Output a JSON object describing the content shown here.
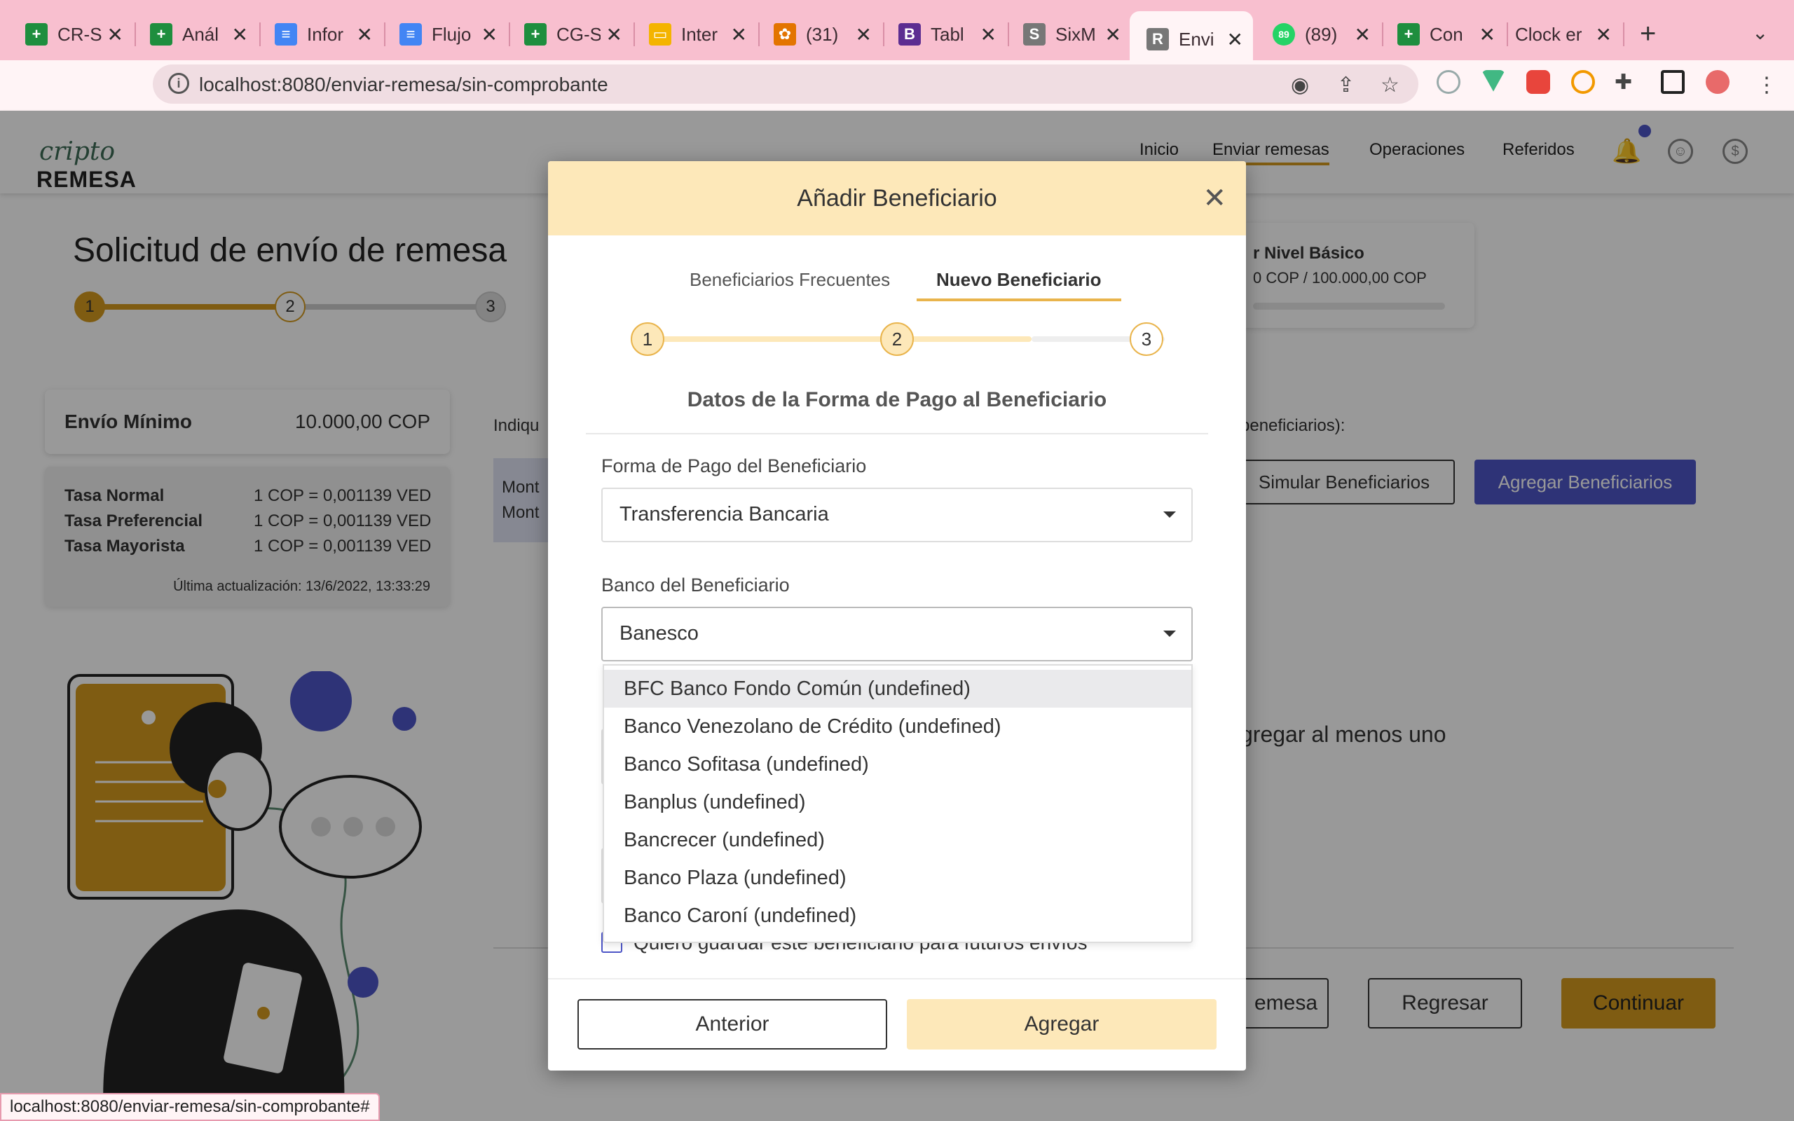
{
  "browser": {
    "tabs": [
      {
        "title": "CR-S",
        "color": "#1e8e3e",
        "glyph": "+"
      },
      {
        "title": "Anál",
        "color": "#1e8e3e",
        "glyph": "+"
      },
      {
        "title": "Infor",
        "color": "#4285f4",
        "glyph": "≡"
      },
      {
        "title": "Flujo",
        "color": "#4285f4",
        "glyph": "≡"
      },
      {
        "title": "CG-S",
        "color": "#1e8e3e",
        "glyph": "+"
      },
      {
        "title": "Inter",
        "color": "#f4b400",
        "glyph": "▭"
      },
      {
        "title": "(31)",
        "color": "#e37400",
        "glyph": "✿"
      },
      {
        "title": "Tabl",
        "color": "#5c2d91",
        "glyph": "B"
      },
      {
        "title": "SixM",
        "color": "#777777",
        "glyph": "S"
      },
      {
        "title": "Envi",
        "color": "#777777",
        "glyph": "R"
      },
      {
        "title": "(89)",
        "color": "#25d366",
        "glyph": "89"
      },
      {
        "title": "Con",
        "color": "#1e8e3e",
        "glyph": "+"
      },
      {
        "title": "Clock er",
        "color": "",
        "glyph": ""
      }
    ],
    "url": "localhost:8080/enviar-remesa/sin-comprobante",
    "status_url": "localhost:8080/enviar-remesa/sin-comprobante#"
  },
  "site": {
    "logo_top": "cripto",
    "logo_bottom": "REMESA",
    "nav": [
      "Inicio",
      "Enviar remesas",
      "Operaciones",
      "Referidos"
    ]
  },
  "page": {
    "title": "Solicitud de envío de remesa",
    "steps": [
      "1",
      "2",
      "3"
    ],
    "min_label": "Envío Mínimo",
    "min_value": "10.000,00 COP",
    "rates": [
      {
        "label": "Tasa Normal",
        "value": "1 COP = 0,001139 VED"
      },
      {
        "label": "Tasa Preferencial",
        "value": "1 COP = 0,001139 VED"
      },
      {
        "label": "Tasa Mayorista",
        "value": "1 COP = 0,001139 VED"
      }
    ],
    "last_update": "Última actualización: 13/6/2022, 13:33:29",
    "limit_title": "r Nivel Básico",
    "limit_value": "0 COP / 100.000,00 COP",
    "indique": "Indiqu",
    "monto_lines": [
      "Mont",
      "Mont"
    ],
    "benef_text": "beneficiarios):",
    "simular_btn": "Simular Beneficiarios",
    "agregar_btn": "Agregar Beneficiarios",
    "agregar_msg": "gregar al menos uno",
    "remesa_btn": "emesa",
    "regresar_btn": "Regresar",
    "continuar_btn": "Continuar"
  },
  "modal": {
    "title": "Añadir Beneficiario",
    "tabs": [
      "Beneficiarios Frecuentes",
      "Nuevo Beneficiario"
    ],
    "steps": [
      "1",
      "2",
      "3"
    ],
    "section_title": "Datos de la Forma de Pago al Beneficiario",
    "payment_label": "Forma de Pago del Beneficiario",
    "payment_value": "Transferencia Bancaria",
    "bank_label": "Banco del Beneficiario",
    "bank_value": "Banesco",
    "bank_options": [
      "BFC Banco Fondo Común (undefined)",
      "Banco Venezolano de Crédito (undefined)",
      "Banco Sofitasa (undefined)",
      "Banplus (undefined)",
      "Bancrecer (undefined)",
      "Banco Plaza (undefined)",
      "Banco Caroní (undefined)"
    ],
    "save_checkbox_label": "Quiero guardar este beneficiario para futuros envíos",
    "save_checked": false,
    "anterior_btn": "Anterior",
    "agregar_btn": "Agregar"
  },
  "colors": {
    "tabbar": "#f8bfcf",
    "accent_gold": "#d49a1e",
    "modal_header": "#fde8b9",
    "primary_blue": "#4d55c7"
  }
}
